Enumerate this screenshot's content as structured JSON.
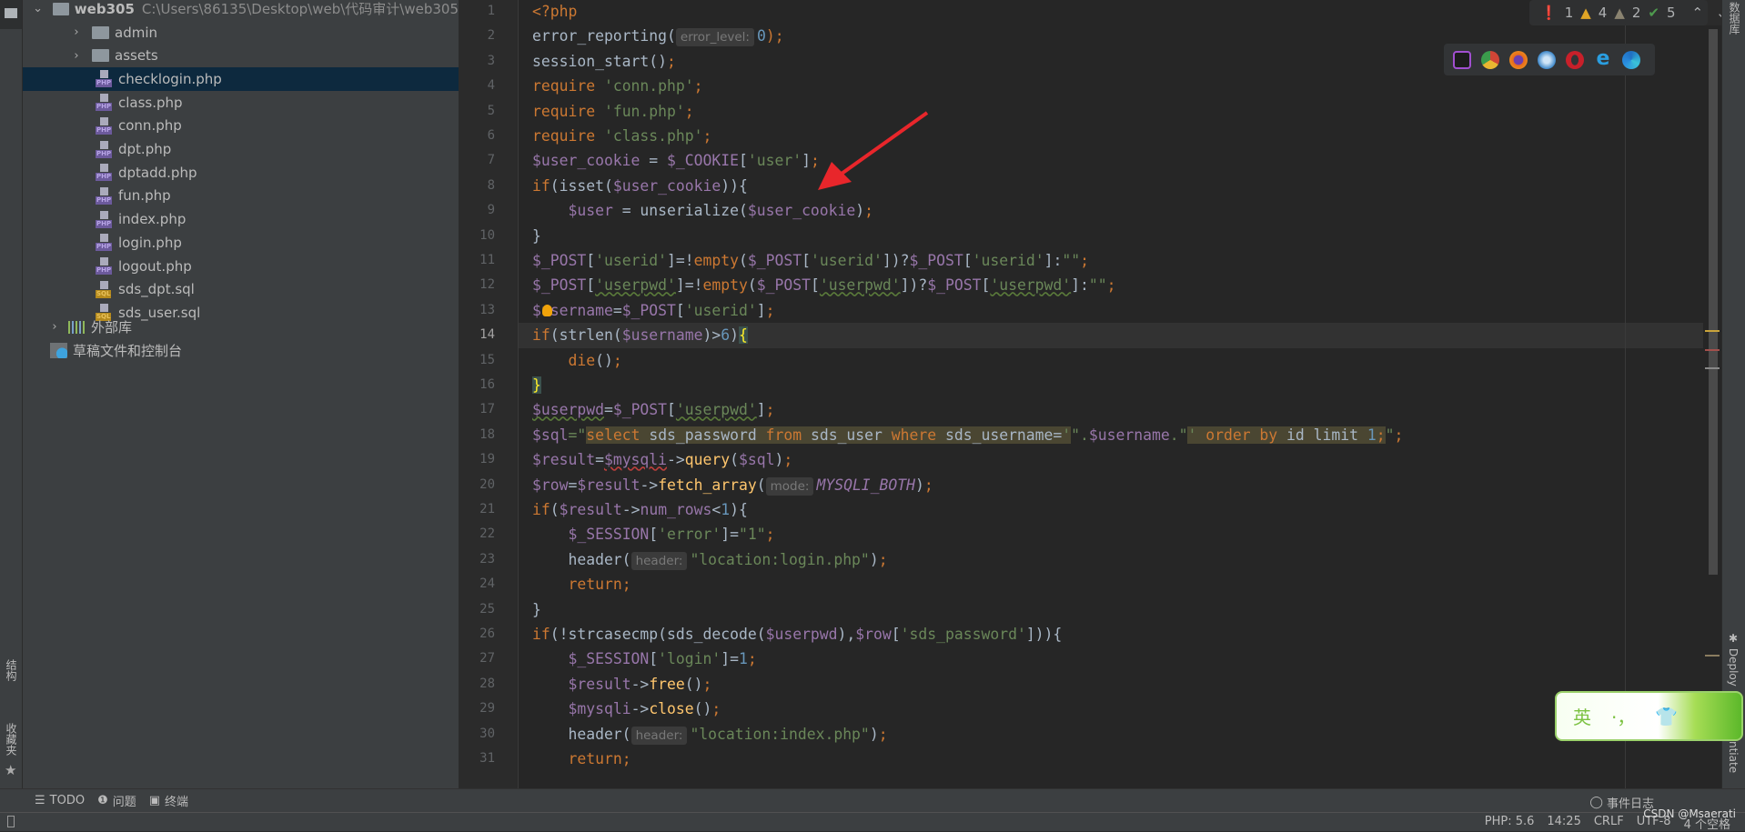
{
  "project": {
    "root": {
      "name": "web305",
      "path": "C:\\Users\\86135\\Desktop\\web\\代码审计\\web305"
    },
    "items": [
      {
        "name": "admin",
        "type": "folder"
      },
      {
        "name": "assets",
        "type": "folder"
      },
      {
        "name": "checklogin.php",
        "type": "php",
        "selected": true
      },
      {
        "name": "class.php",
        "type": "php"
      },
      {
        "name": "conn.php",
        "type": "php"
      },
      {
        "name": "dpt.php",
        "type": "php"
      },
      {
        "name": "dptadd.php",
        "type": "php"
      },
      {
        "name": "fun.php",
        "type": "php"
      },
      {
        "name": "index.php",
        "type": "php"
      },
      {
        "name": "login.php",
        "type": "php"
      },
      {
        "name": "logout.php",
        "type": "php"
      },
      {
        "name": "sds_dpt.sql",
        "type": "sql"
      },
      {
        "name": "sds_user.sql",
        "type": "sql"
      }
    ],
    "external_libs": "外部库",
    "scratches": "草稿文件和控制台",
    "file_badges": {
      "php": "PHP",
      "sql": "SQL"
    }
  },
  "left_strip": {
    "structure": "结构",
    "favorites": "收藏夹"
  },
  "right_strip": {
    "database": "数据库",
    "deploy": "Deploy",
    "other": "ntiate"
  },
  "inspections": {
    "errors": "1",
    "warnings": "4",
    "weak_warnings": "2",
    "typos": "5"
  },
  "browsers": [
    "phpstorm",
    "chrome",
    "firefox",
    "safari",
    "opera",
    "ie",
    "edge"
  ],
  "current_line": 14,
  "code": [
    [
      [
        "<?php",
        "k"
      ]
    ],
    [
      [
        "error_reporting(",
        "t"
      ],
      [
        "error_level:",
        "h"
      ],
      [
        "0",
        "n"
      ],
      [
        ");",
        "k"
      ]
    ],
    [
      [
        "session_start()",
        "t"
      ],
      [
        ";",
        "k"
      ]
    ],
    [
      [
        "require ",
        "k"
      ],
      [
        "'conn.php'",
        "s"
      ],
      [
        ";",
        "k"
      ]
    ],
    [
      [
        "require ",
        "k"
      ],
      [
        "'fun.php'",
        "s"
      ],
      [
        ";",
        "k"
      ]
    ],
    [
      [
        "require ",
        "k"
      ],
      [
        "'class.php'",
        "s"
      ],
      [
        ";",
        "k"
      ]
    ],
    [
      [
        "$user_cookie",
        "v"
      ],
      [
        " = ",
        "t"
      ],
      [
        "$_COOKIE",
        "v"
      ],
      [
        "[",
        "t"
      ],
      [
        "'user'",
        "s"
      ],
      [
        "]",
        "t"
      ],
      [
        ";",
        "k"
      ]
    ],
    [
      [
        "if",
        "k"
      ],
      [
        "(isset(",
        "t"
      ],
      [
        "$user_cookie",
        "v"
      ],
      [
        ")){",
        "t"
      ]
    ],
    [
      [
        "    ",
        "t"
      ],
      [
        "$user",
        "v"
      ],
      [
        " = unserialize(",
        "t"
      ],
      [
        "$user_cookie",
        "v"
      ],
      [
        ")",
        "t"
      ],
      [
        ";",
        "k"
      ]
    ],
    [
      [
        "}",
        "t"
      ]
    ],
    [
      [
        "$_POST",
        "v"
      ],
      [
        "[",
        "t"
      ],
      [
        "'userid'",
        "s"
      ],
      [
        "]=!",
        "t"
      ],
      [
        "empty",
        "k"
      ],
      [
        "(",
        "t"
      ],
      [
        "$_POST",
        "v"
      ],
      [
        "[",
        "t"
      ],
      [
        "'userid'",
        "s"
      ],
      [
        "])?",
        "t"
      ],
      [
        "$_POST",
        "v"
      ],
      [
        "[",
        "t"
      ],
      [
        "'userid'",
        "s"
      ],
      [
        "]:",
        "t"
      ],
      [
        "\"\"",
        "s"
      ],
      [
        ";",
        "k"
      ]
    ],
    [
      [
        "$_POST",
        "v"
      ],
      [
        "[",
        "t"
      ],
      [
        "'userpwd'",
        "s ul"
      ],
      [
        "]=!",
        "t"
      ],
      [
        "empty",
        "k"
      ],
      [
        "(",
        "t"
      ],
      [
        "$_POST",
        "v"
      ],
      [
        "[",
        "t"
      ],
      [
        "'userpwd'",
        "s ul"
      ],
      [
        "])?",
        "t"
      ],
      [
        "$_POST",
        "v"
      ],
      [
        "[",
        "t"
      ],
      [
        "'userpwd'",
        "s ul"
      ],
      [
        "]:",
        "t"
      ],
      [
        "\"\"",
        "s"
      ],
      [
        ";",
        "k"
      ]
    ],
    [
      [
        "$username",
        "v"
      ],
      [
        "=",
        "t"
      ],
      [
        "$_POST",
        "v"
      ],
      [
        "[",
        "t"
      ],
      [
        "'userid'",
        "s"
      ],
      [
        "]",
        "t"
      ],
      [
        ";",
        "k"
      ]
    ],
    [
      [
        "if",
        "k"
      ],
      [
        "(strlen(",
        "t"
      ],
      [
        "$username",
        "v"
      ],
      [
        ")>",
        "t"
      ],
      [
        "6",
        "n"
      ],
      [
        ")",
        "t"
      ],
      [
        "{",
        "br"
      ]
    ],
    [
      [
        "    ",
        "t"
      ],
      [
        "die",
        "k"
      ],
      [
        "()",
        "t"
      ],
      [
        ";",
        "k"
      ]
    ],
    [
      [
        "}",
        "br"
      ]
    ],
    [
      [
        "$userpwd",
        "v ul"
      ],
      [
        "=",
        "t"
      ],
      [
        "$_POST",
        "v"
      ],
      [
        "[",
        "t"
      ],
      [
        "'userpwd'",
        "s ul"
      ],
      [
        "]",
        "t"
      ],
      [
        ";",
        "k"
      ]
    ],
    [
      [
        "$sql",
        "v"
      ],
      [
        "=\"",
        "s"
      ],
      [
        "select",
        "k sq"
      ],
      [
        " sds_password ",
        "t sq"
      ],
      [
        "from",
        "k sq"
      ],
      [
        " sds_user ",
        "t sq"
      ],
      [
        "where",
        "k sq"
      ],
      [
        " sds_username=",
        "t sq"
      ],
      [
        "'",
        "s sq"
      ],
      [
        "\".",
        "s"
      ],
      [
        "$username",
        "v"
      ],
      [
        ".\"",
        "s"
      ],
      [
        "' ",
        "s sq"
      ],
      [
        "order by",
        "k sq"
      ],
      [
        " id ",
        "t sq"
      ],
      [
        "limit ",
        "t sq"
      ],
      [
        "1",
        "n sq"
      ],
      [
        ";",
        "k sq"
      ],
      [
        "\"",
        "s"
      ],
      [
        ";",
        "k"
      ]
    ],
    [
      [
        "$result",
        "v"
      ],
      [
        "=",
        "t"
      ],
      [
        "$mysqli",
        "v ulr"
      ],
      [
        "->",
        "t"
      ],
      [
        "query",
        "f"
      ],
      [
        "(",
        "t"
      ],
      [
        "$sql",
        "v"
      ],
      [
        ")",
        "t"
      ],
      [
        ";",
        "k"
      ]
    ],
    [
      [
        "$row",
        "v"
      ],
      [
        "=",
        "t"
      ],
      [
        "$result",
        "v"
      ],
      [
        "->",
        "t"
      ],
      [
        "fetch_array",
        "f"
      ],
      [
        "(",
        "t"
      ],
      [
        "mode:",
        "h"
      ],
      [
        "MYSQLI_BOTH",
        "i"
      ],
      [
        ")",
        "t"
      ],
      [
        ";",
        "k"
      ]
    ],
    [
      [
        "if",
        "k"
      ],
      [
        "(",
        "t"
      ],
      [
        "$result",
        "v"
      ],
      [
        "->",
        "t"
      ],
      [
        "num_rows",
        "v"
      ],
      [
        "<",
        "t"
      ],
      [
        "1",
        "n"
      ],
      [
        "){",
        "t"
      ]
    ],
    [
      [
        "    ",
        "t"
      ],
      [
        "$_SESSION",
        "v"
      ],
      [
        "[",
        "t"
      ],
      [
        "'error'",
        "s"
      ],
      [
        "]=",
        "t"
      ],
      [
        "\"1\"",
        "s"
      ],
      [
        ";",
        "k"
      ]
    ],
    [
      [
        "    header(",
        "t"
      ],
      [
        "header:",
        "h"
      ],
      [
        "\"location:login.php\"",
        "s"
      ],
      [
        ")",
        "t"
      ],
      [
        ";",
        "k"
      ]
    ],
    [
      [
        "    ",
        "t"
      ],
      [
        "return",
        "k"
      ],
      [
        ";",
        "k"
      ]
    ],
    [
      [
        "}",
        "t"
      ]
    ],
    [
      [
        "if",
        "k"
      ],
      [
        "(!strcasecmp(sds_decode(",
        "t"
      ],
      [
        "$userpwd",
        "v"
      ],
      [
        "),",
        "t"
      ],
      [
        "$row",
        "v"
      ],
      [
        "[",
        "t"
      ],
      [
        "'sds_password'",
        "s"
      ],
      [
        "])){",
        "t"
      ]
    ],
    [
      [
        "    ",
        "t"
      ],
      [
        "$_SESSION",
        "v"
      ],
      [
        "[",
        "t"
      ],
      [
        "'login'",
        "s"
      ],
      [
        "]=",
        "t"
      ],
      [
        "1",
        "n"
      ],
      [
        ";",
        "k"
      ]
    ],
    [
      [
        "    ",
        "t"
      ],
      [
        "$result",
        "v"
      ],
      [
        "->",
        "t"
      ],
      [
        "free",
        "f"
      ],
      [
        "()",
        "t"
      ],
      [
        ";",
        "k"
      ]
    ],
    [
      [
        "    ",
        "t"
      ],
      [
        "$mysqli",
        "v"
      ],
      [
        "->",
        "t"
      ],
      [
        "close",
        "f"
      ],
      [
        "()",
        "t"
      ],
      [
        ";",
        "k"
      ]
    ],
    [
      [
        "    header(",
        "t"
      ],
      [
        "header:",
        "h"
      ],
      [
        "\"location:index.php\"",
        "s"
      ],
      [
        ")",
        "t"
      ],
      [
        ";",
        "k"
      ]
    ],
    [
      [
        "    ",
        "t"
      ],
      [
        "return",
        "k"
      ],
      [
        ";",
        "k"
      ]
    ]
  ],
  "ime": {
    "lang": "英",
    "punct": "·，"
  },
  "toolbar": {
    "todo": "TODO",
    "problems": "问题",
    "terminal": "终端",
    "event_log": "事件日志"
  },
  "status": {
    "php": "PHP: 5.6",
    "position": "14:25",
    "line_sep": "CRLF",
    "encoding": "UTF-8",
    "indent": "4 个空格"
  },
  "watermark": "CSDN @Msaerati",
  "colors": {
    "arrow": "#e8262b",
    "selection": "#0d293e",
    "keyword": "#cc7832",
    "string": "#6a8759",
    "variable": "#9876aa"
  }
}
